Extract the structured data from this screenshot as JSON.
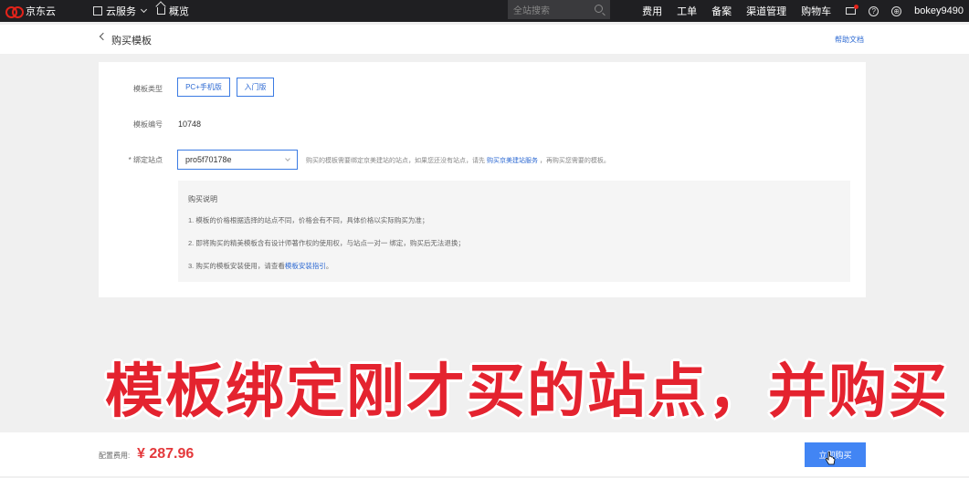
{
  "topnav": {
    "logo": "京东云",
    "cloud_services": "云服务",
    "overview": "概览",
    "search_placeholder": "全站搜索",
    "menu": [
      "费用",
      "工单",
      "备案",
      "渠道管理",
      "购物车"
    ],
    "help_glyph": "?",
    "username": "bokey9490"
  },
  "header": {
    "title": "购买模板",
    "help_link": "帮助文档"
  },
  "form": {
    "template_type_label": "模板类型",
    "template_type_options": [
      "PC+手机版",
      "入门版"
    ],
    "template_id_label": "模板编号",
    "template_id_value": "10748",
    "bind_site_label": "* 绑定站点",
    "bind_site_value": "pro5f70178e",
    "hint_prefix": "购买的模板需要绑定京美建站的站点，如果您还没有站点，请先 ",
    "hint_link": "购买京美建站服务",
    "hint_suffix": " ，再购买您需要的模板。"
  },
  "notice": {
    "title": "购买说明",
    "item1": "1. 模板的价格根据选择的站点不同，价格会有不同，具体价格以实际购买为准；",
    "item2": "2. 即将购买的精美模板含有设计师著作权的使用权，与站点一对一 绑定，购买后无法退换；",
    "item3_prefix": "3. 购买的模板安装使用，请查看",
    "item3_link": "模板安装指引",
    "item3_suffix": "。"
  },
  "caption": "模板绑定刚才买的站点，并购买",
  "footer": {
    "fee_label": "配置费用:",
    "price": "¥ 287.96",
    "buy_button": "立即购买"
  },
  "colors": {
    "accent": "#4285f4",
    "price": "#e4393c",
    "caption": "#e4232f",
    "nav_bg": "#1f1f22"
  }
}
